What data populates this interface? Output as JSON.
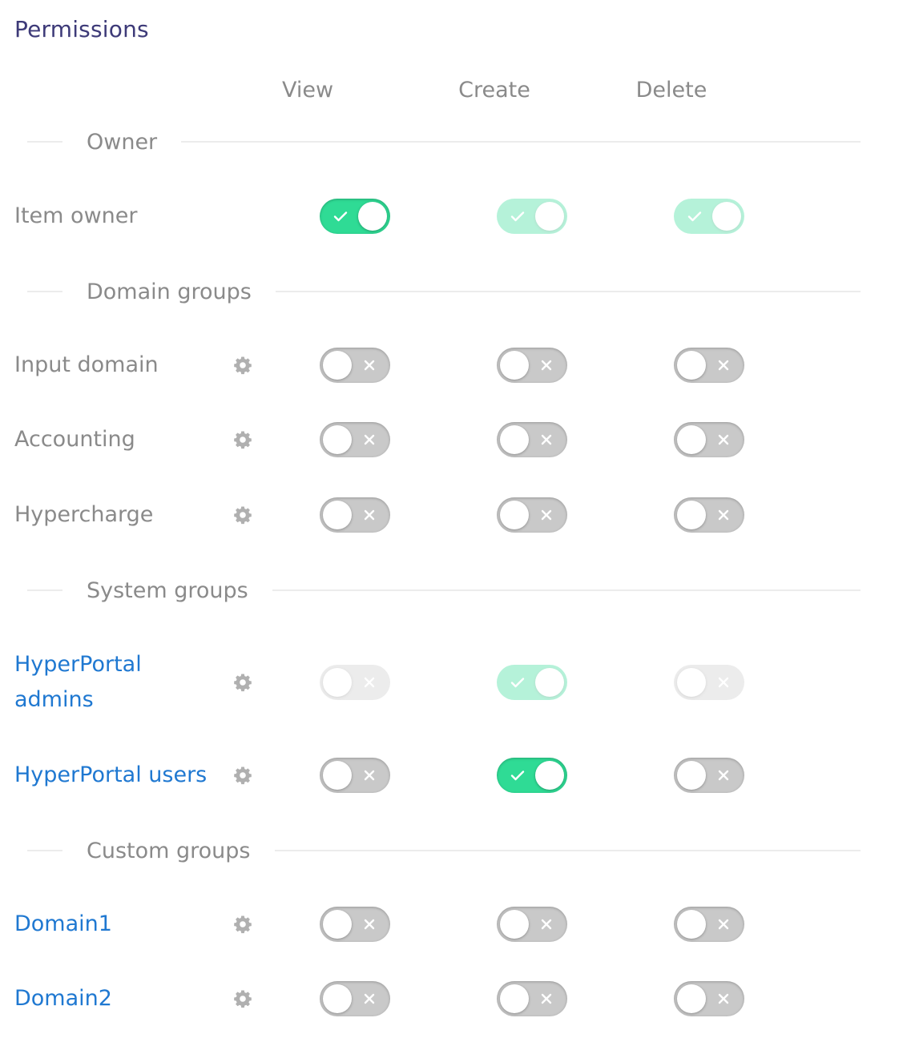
{
  "title": "Permissions",
  "columns": [
    "View",
    "Create",
    "Delete"
  ],
  "sections": [
    {
      "label": "Owner"
    },
    {
      "label": "Domain groups"
    },
    {
      "label": "System groups"
    },
    {
      "label": "Custom groups"
    }
  ],
  "rows": [
    {
      "label": "Item owner",
      "link": false,
      "has_settings": false,
      "view": "on",
      "create": "on-disabled",
      "delete": "on-disabled"
    },
    {
      "label": "Input domain",
      "link": false,
      "has_settings": true,
      "view": "off",
      "create": "off",
      "delete": "off"
    },
    {
      "label": "Accounting",
      "link": false,
      "has_settings": true,
      "view": "off",
      "create": "off",
      "delete": "off"
    },
    {
      "label": "Hypercharge",
      "link": false,
      "has_settings": true,
      "view": "off",
      "create": "off",
      "delete": "off"
    },
    {
      "label_line1": "HyperPortal",
      "label_line2": "admins",
      "link": true,
      "has_settings": true,
      "view": "off-disabled",
      "create": "on-disabled",
      "delete": "off-disabled"
    },
    {
      "label": "HyperPortal users",
      "link": true,
      "has_settings": true,
      "view": "off",
      "create": "on",
      "delete": "off"
    },
    {
      "label": "Domain1",
      "link": true,
      "has_settings": true,
      "view": "off",
      "create": "off",
      "delete": "off"
    },
    {
      "label": "Domain2",
      "link": true,
      "has_settings": true,
      "view": "off",
      "create": "off",
      "delete": "off"
    }
  ],
  "icons": {
    "settings": "gear-icon",
    "toggle_on": "check-icon",
    "toggle_off": "cross-icon"
  },
  "colors": {
    "title": "#3d3a78",
    "link": "#1f78d1",
    "muted_text": "#8a8a8a",
    "toggle_on": "#2fdb95",
    "toggle_off": "#c9c9c9"
  }
}
